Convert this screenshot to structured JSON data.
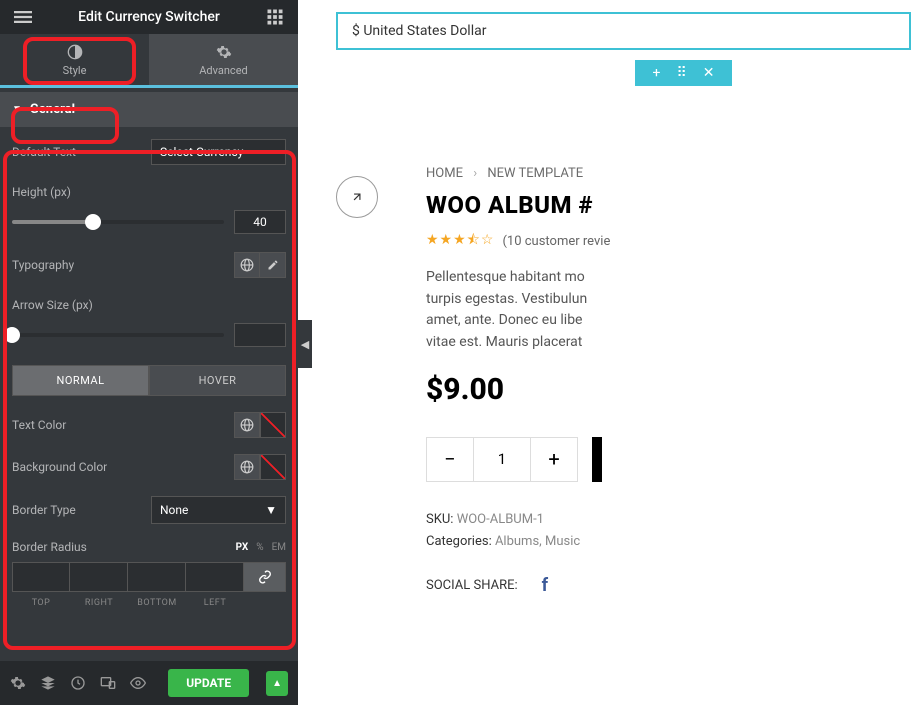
{
  "header": {
    "title": "Edit Currency Switcher"
  },
  "tabs": {
    "style": "Style",
    "advanced": "Advanced"
  },
  "section": {
    "general": "General"
  },
  "controls": {
    "default_text_label": "Default Text",
    "default_text_value": "Select Currency",
    "height_label": "Height (px)",
    "height_value": "40",
    "typography_label": "Typography",
    "arrow_label": "Arrow Size (px)",
    "arrow_value": "",
    "normal": "NORMAL",
    "hover": "HOVER",
    "text_color_label": "Text Color",
    "bg_color_label": "Background Color",
    "border_type_label": "Border Type",
    "border_type_value": "None",
    "border_radius_label": "Border Radius",
    "units": {
      "px": "PX",
      "pct": "%",
      "em": "EM"
    },
    "radius_sides": {
      "top": "TOP",
      "right": "RIGHT",
      "bottom": "BOTTOM",
      "left": "LEFT"
    }
  },
  "footer": {
    "update": "UPDATE"
  },
  "preview": {
    "currency": "$ United States Dollar",
    "breadcrumb": {
      "home": "HOME",
      "page": "NEW TEMPLATE"
    },
    "product_title": "WOO ALBUM #",
    "reviews": "(10 customer revie",
    "description": "Pellentesque habitant mo\nturpis egestas. Vestibulun\namet, ante. Donec eu libe\nvitae est. Mauris placerat",
    "price": "$9.00",
    "qty": "1",
    "sku_label": "SKU:",
    "sku_value": "WOO-ALBUM-1",
    "categories_label": "Categories:",
    "cat1": "Albums",
    "cat2": "Music",
    "social_label": "SOCIAL SHARE:"
  }
}
